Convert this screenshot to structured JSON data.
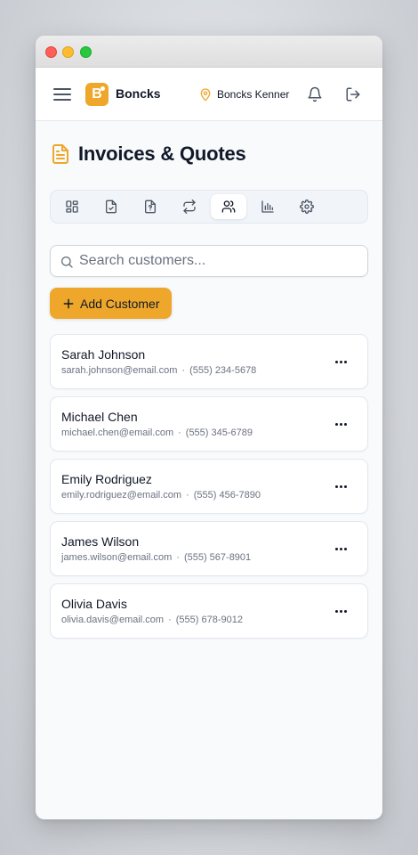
{
  "app": {
    "brand": "Boncks",
    "logo_letter": "B",
    "accent": "#eea72a"
  },
  "header": {
    "location_name": "Boncks Kenner"
  },
  "page": {
    "title": "Invoices & Quotes"
  },
  "tabs": [
    {
      "icon": "dashboard-icon",
      "active": false
    },
    {
      "icon": "invoice-icon",
      "active": false
    },
    {
      "icon": "quote-icon",
      "active": false
    },
    {
      "icon": "recurring-icon",
      "active": false
    },
    {
      "icon": "customers-icon",
      "active": true
    },
    {
      "icon": "reports-icon",
      "active": false
    },
    {
      "icon": "settings-icon",
      "active": false
    }
  ],
  "search": {
    "placeholder": "Search customers...",
    "value": ""
  },
  "actions": {
    "add_customer_label": "Add Customer"
  },
  "customers": [
    {
      "name": "Sarah Johnson",
      "email": "sarah.johnson@email.com",
      "separator": "·",
      "phone": "(555) 234-5678"
    },
    {
      "name": "Michael Chen",
      "email": "michael.chen@email.com",
      "separator": "·",
      "phone": "(555) 345-6789"
    },
    {
      "name": "Emily Rodriguez",
      "email": "emily.rodriguez@email.com",
      "separator": "·",
      "phone": "(555) 456-7890"
    },
    {
      "name": "James Wilson",
      "email": "james.wilson@email.com",
      "separator": "·",
      "phone": "(555) 567-8901"
    },
    {
      "name": "Olivia Davis",
      "email": "olivia.davis@email.com",
      "separator": "·",
      "phone": "(555) 678-9012"
    }
  ]
}
